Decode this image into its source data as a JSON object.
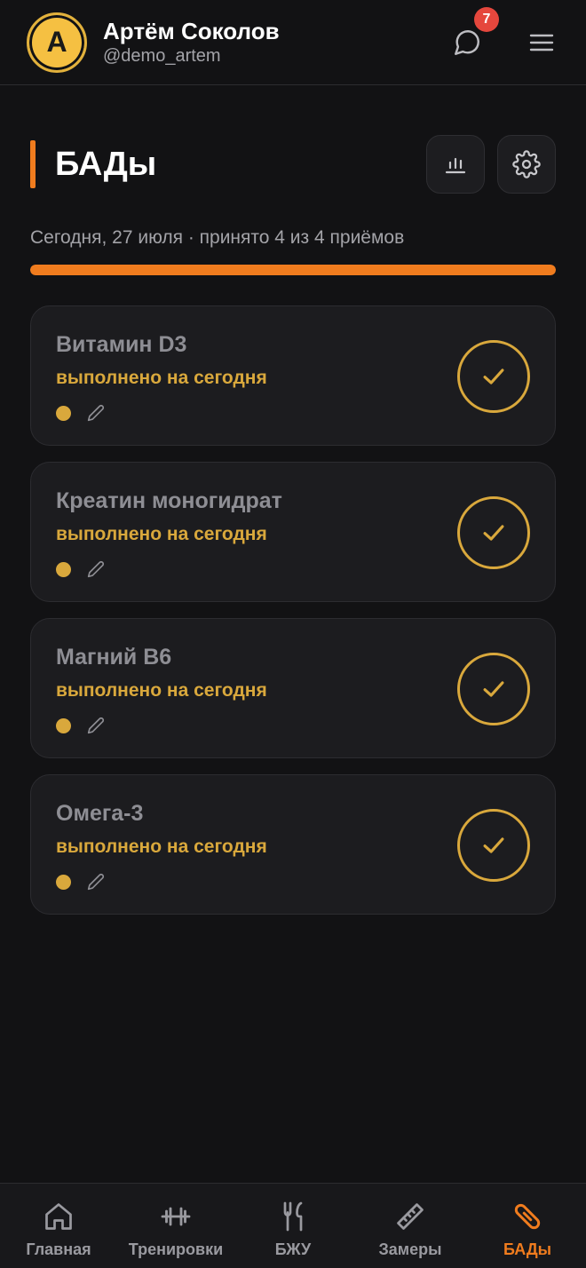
{
  "header": {
    "avatar_letter": "А",
    "user_name": "Артём Соколов",
    "user_handle": "@demo_artem",
    "notifications_count": "7"
  },
  "page": {
    "title": "БАДы",
    "date_line": "Сегодня, 27 июля · принято 4 из 4 приёмов",
    "progress_fraction": 1.0
  },
  "supplements": [
    {
      "name": "Витамин D3",
      "status": "выполнено на сегодня"
    },
    {
      "name": "Креатин моногидрат",
      "status": "выполнено на сегодня"
    },
    {
      "name": "Магний B6",
      "status": "выполнено на сегодня"
    },
    {
      "name": "Омега-3",
      "status": "выполнено на сегодня"
    }
  ],
  "nav": [
    {
      "label": "Главная",
      "icon": "home-icon"
    },
    {
      "label": "Тренировки",
      "icon": "dumbbell-icon"
    },
    {
      "label": "БЖУ",
      "icon": "fork-knife-icon"
    },
    {
      "label": "Замеры",
      "icon": "ruler-icon"
    },
    {
      "label": "БАДы",
      "icon": "pill-icon",
      "active": true
    }
  ],
  "colors": {
    "accent": "#f07c1e",
    "done": "#d9a83c",
    "badge": "#e5473d",
    "background": "#121214"
  }
}
